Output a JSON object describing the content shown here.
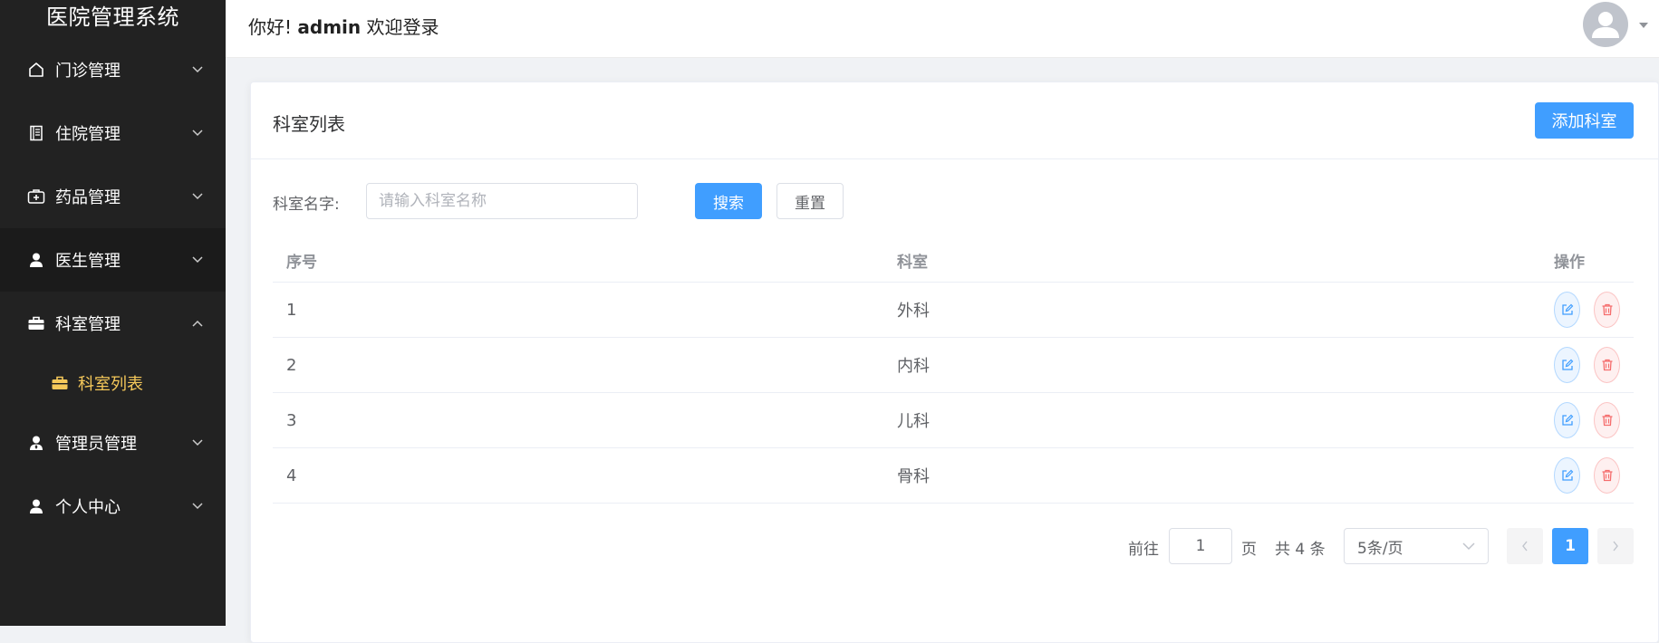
{
  "app": {
    "title": "医院管理系统"
  },
  "sidebar": {
    "items": [
      {
        "label": "门诊管理",
        "icon": "home-icon",
        "expanded": false
      },
      {
        "label": "住院管理",
        "icon": "document-icon",
        "expanded": false
      },
      {
        "label": "药品管理",
        "icon": "medkit-icon",
        "expanded": false
      },
      {
        "label": "医生管理",
        "icon": "user-icon",
        "expanded": false
      },
      {
        "label": "科室管理",
        "icon": "briefcase-icon",
        "expanded": true
      },
      {
        "label": "管理员管理",
        "icon": "user-icon",
        "expanded": false
      },
      {
        "label": "个人中心",
        "icon": "user-icon",
        "expanded": false
      }
    ],
    "sub_item": {
      "label": "科室列表",
      "icon": "briefcase-icon",
      "color": "#f5c85a"
    }
  },
  "header": {
    "greeting_prefix": "你好!",
    "username": "admin",
    "greeting_suffix": "欢迎登录"
  },
  "card": {
    "title": "科室列表",
    "add_button": "添加科室"
  },
  "search": {
    "label": "科室名字:",
    "placeholder": "请输入科室名称",
    "search_button": "搜索",
    "reset_button": "重置"
  },
  "table": {
    "columns": [
      "序号",
      "科室",
      "操作"
    ],
    "rows": [
      {
        "index": "1",
        "name": "外科"
      },
      {
        "index": "2",
        "name": "内科"
      },
      {
        "index": "3",
        "name": "儿科"
      },
      {
        "index": "4",
        "name": "骨科"
      }
    ]
  },
  "pagination": {
    "goto_prefix": "前往",
    "goto_value": "1",
    "goto_suffix": "页",
    "total": "共 4 条",
    "page_size": "5条/页",
    "current_page": "1"
  },
  "colors": {
    "sidebar_bg": "#222222",
    "primary": "#409eff",
    "active_sub": "#f5c85a",
    "danger": "#f56c6c"
  }
}
